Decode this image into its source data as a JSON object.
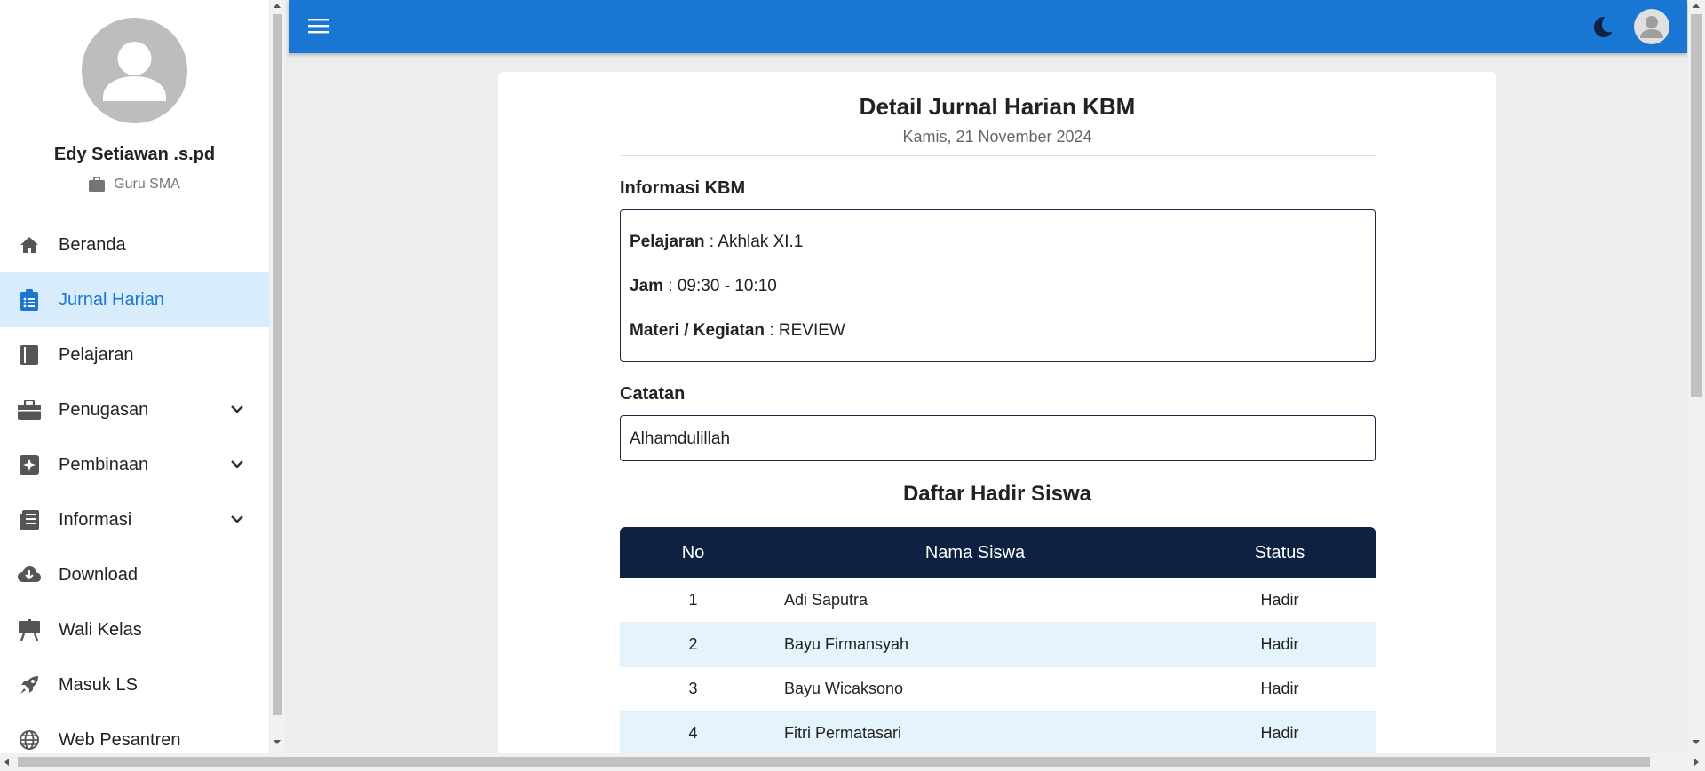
{
  "user": {
    "name": "Edy Setiawan .s.pd",
    "role": "Guru SMA"
  },
  "nav": [
    {
      "label": "Beranda",
      "icon": "home-icon",
      "active": false,
      "expandable": false
    },
    {
      "label": "Jurnal Harian",
      "icon": "clipboard-list-icon",
      "active": true,
      "expandable": false
    },
    {
      "label": "Pelajaran",
      "icon": "book-icon",
      "active": false,
      "expandable": false
    },
    {
      "label": "Penugasan",
      "icon": "briefcase-icon",
      "active": false,
      "expandable": true
    },
    {
      "label": "Pembinaan",
      "icon": "sparkle-icon",
      "active": false,
      "expandable": true
    },
    {
      "label": "Informasi",
      "icon": "newspaper-icon",
      "active": false,
      "expandable": true
    },
    {
      "label": "Download",
      "icon": "cloud-download-icon",
      "active": false,
      "expandable": false
    },
    {
      "label": "Wali Kelas",
      "icon": "easel-icon",
      "active": false,
      "expandable": false
    },
    {
      "label": "Masuk LS",
      "icon": "rocket-icon",
      "active": false,
      "expandable": false
    },
    {
      "label": "Web Pesantren",
      "icon": "globe-icon",
      "active": false,
      "expandable": false
    }
  ],
  "colors": {
    "primary": "#1976d2",
    "active_bg": "#d9ecfc",
    "table_header": "#0e2142",
    "row_alt": "#e5f3fd"
  },
  "detail": {
    "title": "Detail Jurnal Harian KBM",
    "date": "Kamis, 21 November 2024",
    "info_label": "Informasi KBM",
    "pelajaran_label": "Pelajaran",
    "pelajaran_value": " : Akhlak XI.1",
    "jam_label": "Jam",
    "jam_value": " : 09:30 - 10:10",
    "materi_label": "Materi / Kegiatan",
    "materi_value": " : REVIEW",
    "catatan_label": "Catatan",
    "catatan_value": "Alhamdulillah"
  },
  "attendance": {
    "title": "Daftar Hadir Siswa",
    "headers": {
      "no": "No",
      "name": "Nama Siswa",
      "status": "Status"
    },
    "rows": [
      {
        "no": "1",
        "name": "Adi Saputra",
        "status": "Hadir"
      },
      {
        "no": "2",
        "name": "Bayu Firmansyah",
        "status": "Hadir"
      },
      {
        "no": "3",
        "name": "Bayu Wicaksono",
        "status": "Hadir"
      },
      {
        "no": "4",
        "name": "Fitri Permatasari",
        "status": "Hadir"
      }
    ]
  }
}
